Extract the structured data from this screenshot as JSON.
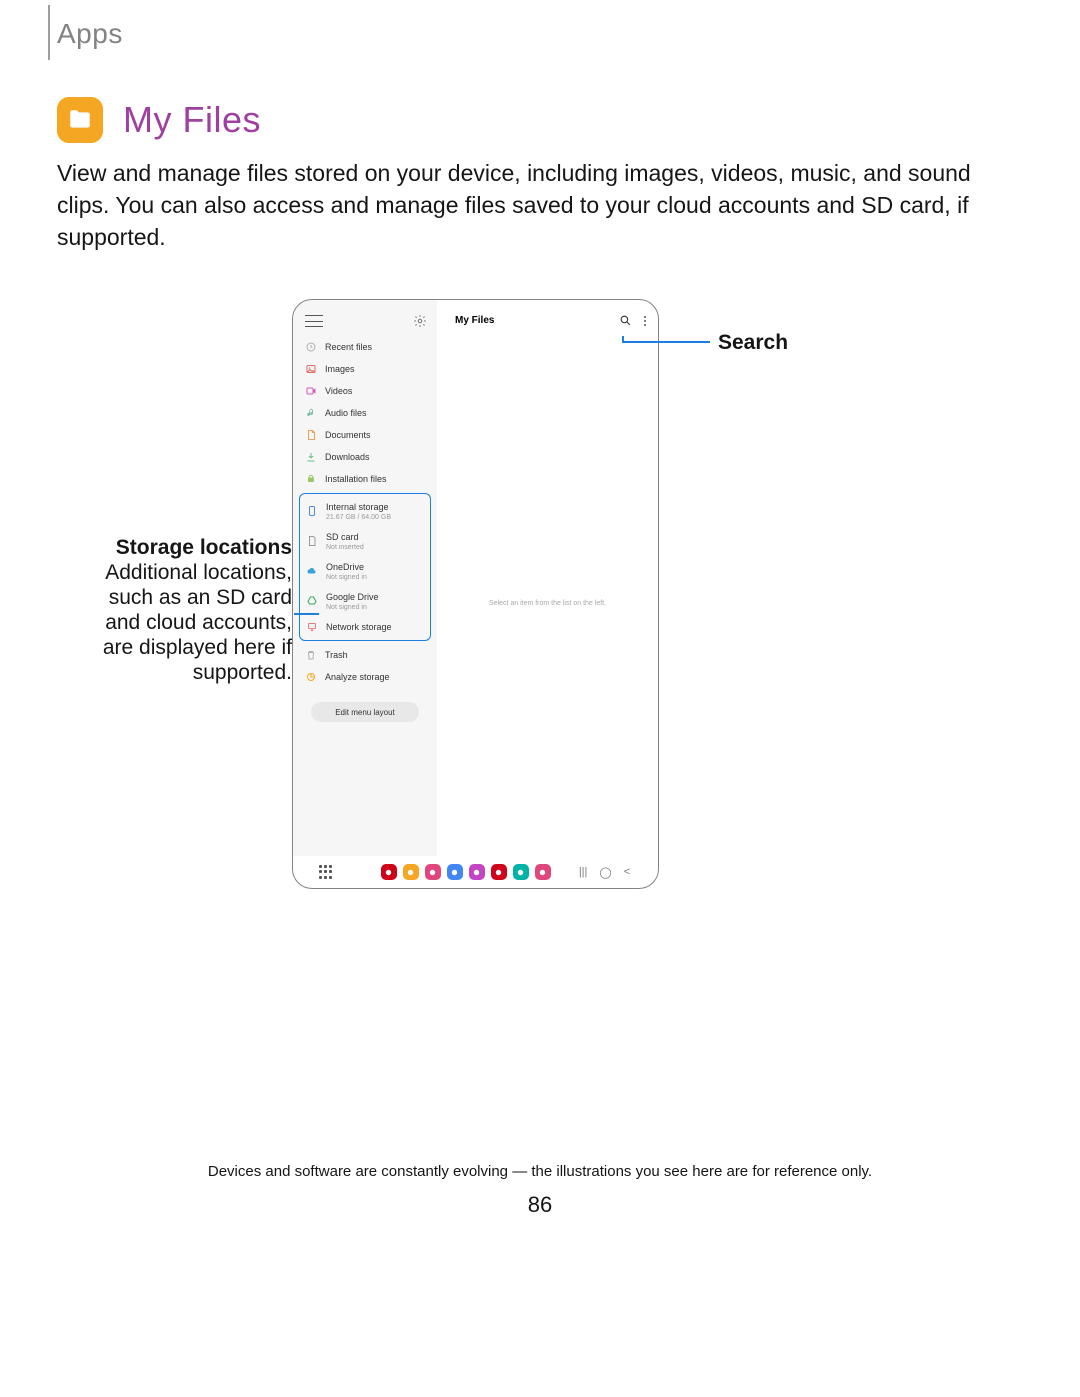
{
  "header": {
    "section": "Apps",
    "title": "My Files"
  },
  "description": "View and manage files stored on your device, including images, videos, music, and sound clips. You can also access and manage files saved to your cloud accounts and SD card, if supported.",
  "device": {
    "main_title": "My Files",
    "main_hint": "Select an item from the list on the left.",
    "sidebar": {
      "categories": [
        {
          "icon": "clock",
          "label": "Recent files",
          "color": "#b0b0b0"
        },
        {
          "icon": "image",
          "label": "Images",
          "color": "#e26a6a"
        },
        {
          "icon": "video",
          "label": "Videos",
          "color": "#d05bb8"
        },
        {
          "icon": "audio",
          "label": "Audio files",
          "color": "#7cc3a6"
        },
        {
          "icon": "doc",
          "label": "Documents",
          "color": "#f0a05a"
        },
        {
          "icon": "download",
          "label": "Downloads",
          "color": "#64c27e"
        },
        {
          "icon": "apk",
          "label": "Installation files",
          "color": "#97c965"
        }
      ],
      "storage": [
        {
          "icon": "phone",
          "label": "Internal storage",
          "sub": "21.67 GB / 64.00 GB",
          "color": "#4a90e2"
        },
        {
          "icon": "sd",
          "label": "SD card",
          "sub": "Not inserted",
          "color": "#9b9b9b"
        },
        {
          "icon": "cloud",
          "label": "OneDrive",
          "sub": "Not signed in",
          "color": "#3aa0dc"
        },
        {
          "icon": "gdrive",
          "label": "Google Drive",
          "sub": "Not signed in",
          "color": "#34a853"
        },
        {
          "icon": "network",
          "label": "Network storage",
          "sub": "",
          "color": "#e57f7f"
        }
      ],
      "footer": [
        {
          "icon": "trash",
          "label": "Trash",
          "color": "#b0b0b0"
        },
        {
          "icon": "analyze",
          "label": "Analyze storage",
          "color": "#f5a623"
        }
      ],
      "edit_button": "Edit menu layout"
    },
    "taskbar_colors": [
      "#d0021b",
      "#f5a623",
      "#e0457b",
      "#4285f4",
      "#c445c4",
      "#d0021b",
      "#00b3a6",
      "#e0457b"
    ]
  },
  "callouts": {
    "search": "Search",
    "storage_title": "Storage locations",
    "storage_body": "Additional locations, such as an SD card and cloud accounts, are displayed here if supported."
  },
  "footer_note": "Devices and software are constantly evolving — the illustrations you see here are for reference only.",
  "page_number": "86"
}
